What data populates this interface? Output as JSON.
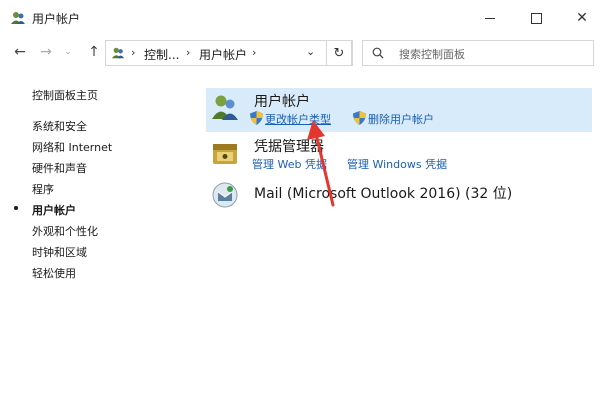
{
  "window": {
    "title": "用户帐户",
    "minimize_label": "—",
    "close_label": "✕"
  },
  "nav": {
    "back": "←",
    "forward": "→",
    "dropdown": "⌄",
    "up": "↑"
  },
  "address": {
    "sep1": "›",
    "crumb1": "控制...",
    "sep2": "›",
    "crumb2": "用户帐户",
    "sep3": "›",
    "dropdown": "⌄",
    "refresh": "↻"
  },
  "search": {
    "placeholder": "搜索控制面板"
  },
  "sidebar": {
    "items": [
      {
        "label": "控制面板主页"
      },
      {
        "label": "系统和安全"
      },
      {
        "label": "网络和 Internet"
      },
      {
        "label": "硬件和声音"
      },
      {
        "label": "程序"
      },
      {
        "label": "用户帐户",
        "current": true
      },
      {
        "label": "外观和个性化"
      },
      {
        "label": "时钟和区域"
      },
      {
        "label": "轻松使用"
      }
    ]
  },
  "categories": {
    "user_accounts": {
      "title": "用户帐户",
      "link1": "更改帐户类型",
      "link2": "删除用户帐户"
    },
    "credential_manager": {
      "title": "凭据管理器",
      "link1": "管理 Web 凭据",
      "link2": "管理 Windows 凭据"
    },
    "mail": {
      "title": "Mail (Microsoft Outlook 2016) (32 位)"
    }
  },
  "colors": {
    "highlight": "#d8ebfa",
    "link": "#1a5fb4",
    "arrow": "#e2372f"
  }
}
